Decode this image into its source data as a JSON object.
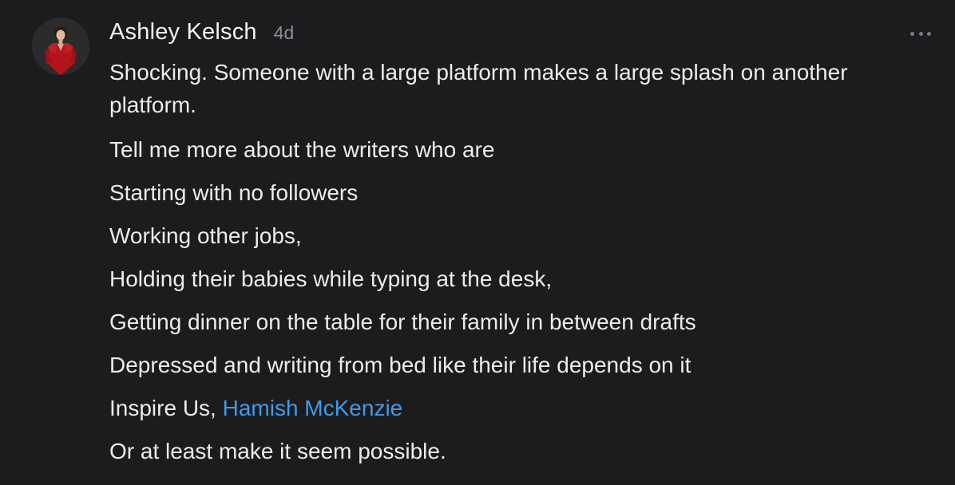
{
  "comment": {
    "author": "Ashley Kelsch",
    "timestamp": "4d",
    "paragraphs": [
      "Shocking. Someone with a large platform makes a large splash on another platform.",
      "Tell me more about the writers who are",
      "Starting with no followers",
      "Working other jobs,",
      "Holding their babies while typing at the desk,",
      "Getting dinner on the table for their family in between drafts",
      "Depressed and writing from bed like their life depends on it"
    ],
    "inspire_prefix": "Inspire Us, ",
    "mention": "Hamish McKenzie",
    "closing": "Or at least make it seem possible.",
    "more_icon": "ellipsis-icon",
    "avatar_icon": "user-avatar"
  },
  "colors": {
    "background": "#1c1c1e",
    "text": "#ececec",
    "muted": "#8e8e93",
    "mention": "#3f9bea"
  }
}
